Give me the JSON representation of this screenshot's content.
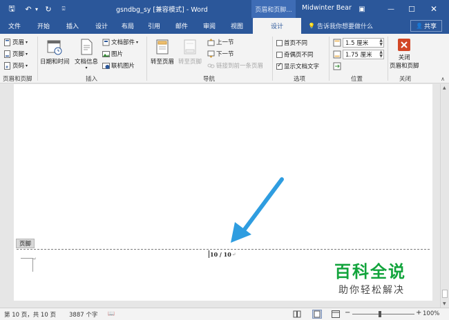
{
  "titlebar": {
    "document_title": "gsndbg_sy [兼容模式]  -  Word",
    "context_tab": "页眉和页脚...",
    "user": "Midwinter Bear",
    "quick_access": {
      "save": "🖫",
      "undo": "↶",
      "undo_dropdown": "▾",
      "redo": "↻",
      "customize": "⍗"
    },
    "window_controls": {
      "ribbon_options": "▣",
      "minimize": "—",
      "maximize": "☐",
      "close": "✕"
    }
  },
  "tabs": [
    {
      "label": "文件",
      "active": false
    },
    {
      "label": "开始",
      "active": false
    },
    {
      "label": "插入",
      "active": false
    },
    {
      "label": "设计",
      "active": false
    },
    {
      "label": "布局",
      "active": false
    },
    {
      "label": "引用",
      "active": false
    },
    {
      "label": "邮件",
      "active": false
    },
    {
      "label": "审阅",
      "active": false
    },
    {
      "label": "视图",
      "active": false
    },
    {
      "label": "设计",
      "active": true
    }
  ],
  "tellme": {
    "icon": "💡",
    "text": "告诉我你想要做什么"
  },
  "share": {
    "icon": "👤",
    "label": "共享"
  },
  "ribbon": {
    "header_footer_group": {
      "label": "页眉和页脚",
      "items": [
        "页眉",
        "页脚",
        "页码"
      ]
    },
    "insert_group": {
      "label": "插入",
      "datetime": "日期和时间",
      "docinfo": "文档信息",
      "docparts": "文档部件",
      "picture": "图片",
      "online_picture": "联机图片"
    },
    "nav_group": {
      "label": "导航",
      "goto_header": "转至页眉",
      "goto_footer": "转至页脚",
      "prev": "上一节",
      "next": "下一节",
      "link_prev": "链接到前一条页眉"
    },
    "options_group": {
      "label": "选项",
      "options": [
        {
          "label": "首页不同",
          "checked": false
        },
        {
          "label": "奇偶页不同",
          "checked": false
        },
        {
          "label": "显示文档文字",
          "checked": true
        }
      ]
    },
    "position_group": {
      "label": "位置",
      "header_distance": "1.5 厘米",
      "footer_distance": "1.75 厘米"
    },
    "close_group": {
      "label": "关闭",
      "close_line1": "关闭",
      "close_line2": "页眉和页脚"
    },
    "collapse": "∧"
  },
  "document": {
    "footer_tag": "页脚",
    "page_number_text": "10 / 10",
    "para_mark": "↵"
  },
  "watermark": {
    "title": "百科全说",
    "subtitle": "助你轻松解决"
  },
  "statusbar": {
    "page_info": "第 10 页，共 10 页",
    "word_count": "3887 个字",
    "proofing_icon": "📖",
    "zoom_minus": "−",
    "zoom_plus": "+",
    "zoom": "100%",
    "zoom_level": 1.0
  },
  "colors": {
    "accent": "#2b579a",
    "arrow": "#2f9de0",
    "watermark_green": "#12a43c"
  }
}
